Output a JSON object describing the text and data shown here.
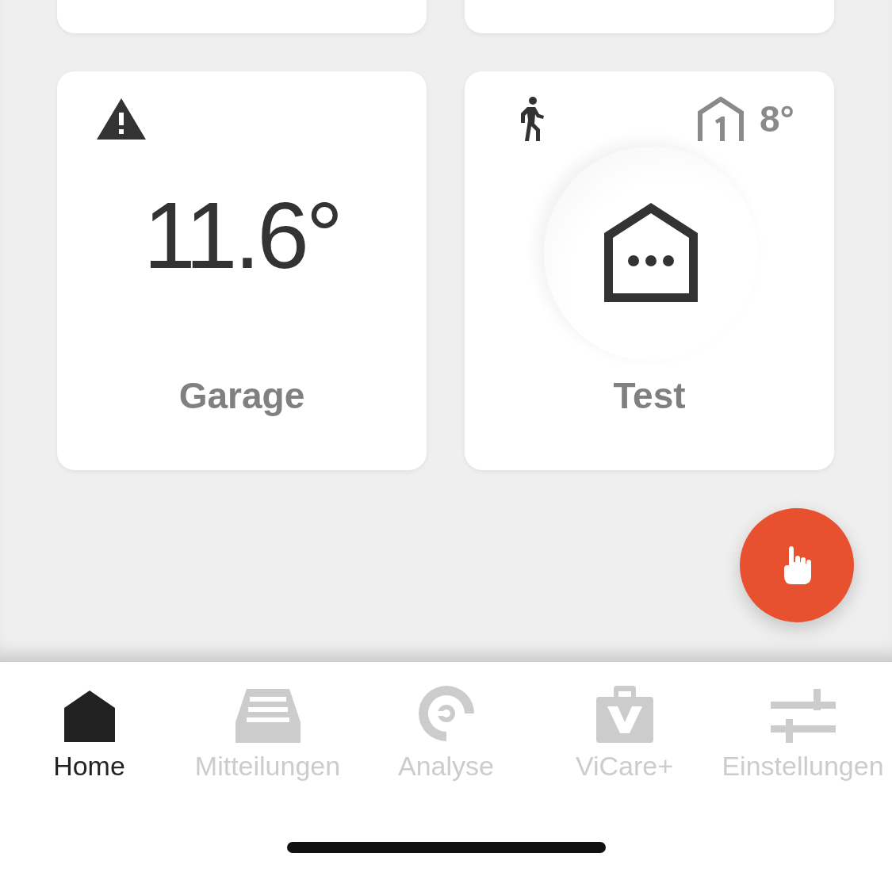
{
  "top_cards": [
    {
      "kind": "empty"
    },
    {
      "kind": "empty"
    }
  ],
  "rooms": [
    {
      "kind": "warning",
      "temperature": "11.6°",
      "name": "Garage"
    },
    {
      "kind": "presence",
      "floor_temp": "8°",
      "name": "Test"
    }
  ],
  "tabs": [
    {
      "label": "Home",
      "selected": true
    },
    {
      "label": "Mitteilungen",
      "selected": false
    },
    {
      "label": "Analyse",
      "selected": false
    },
    {
      "label": "ViCare+",
      "selected": false
    },
    {
      "label": "Einstellungen",
      "selected": false
    }
  ]
}
